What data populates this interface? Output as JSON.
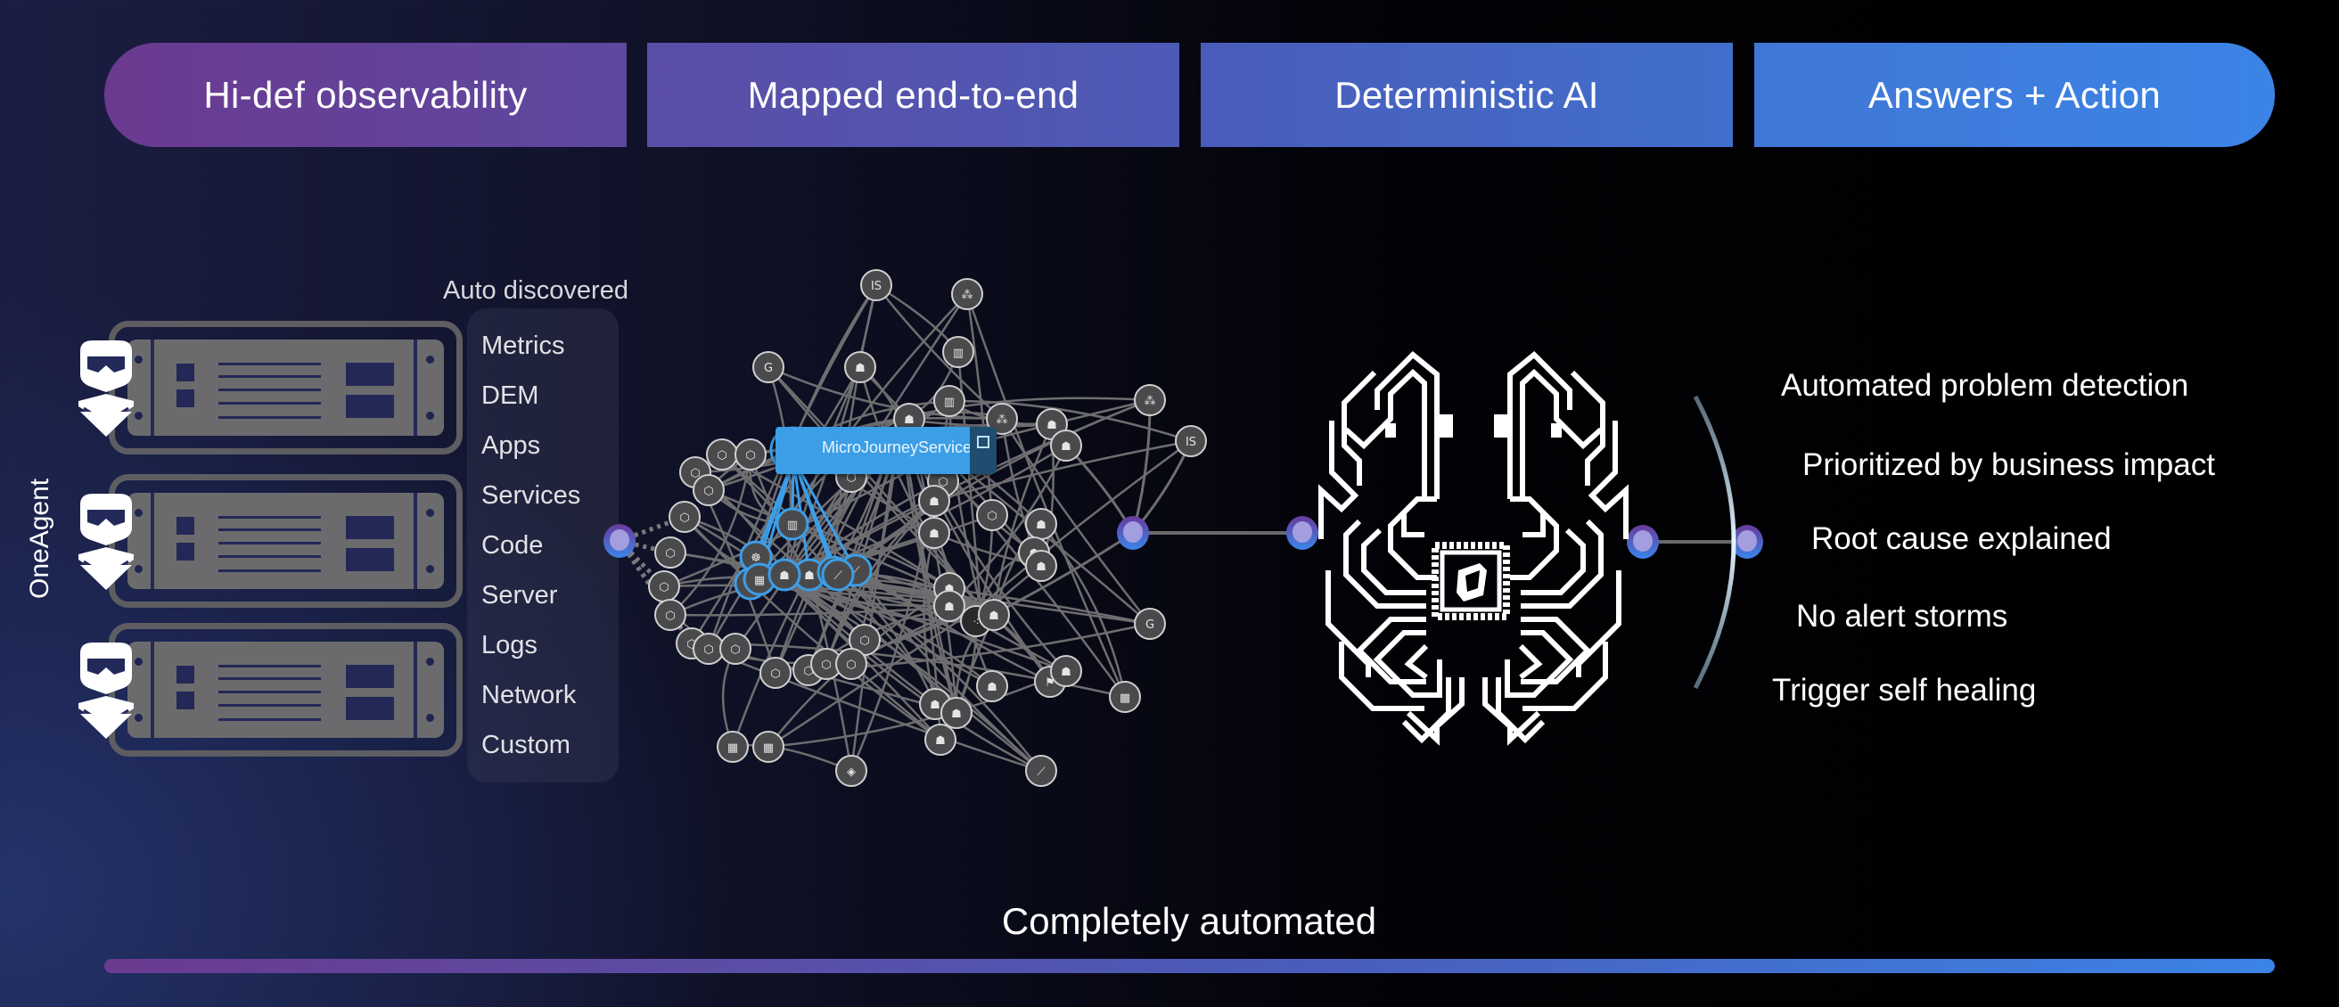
{
  "stages": [
    {
      "label": "Hi-def observability"
    },
    {
      "label": "Mapped end-to-end"
    },
    {
      "label": "Deterministic AI"
    },
    {
      "label": "Answers + Action"
    }
  ],
  "agent": {
    "label": "OneAgent",
    "icon": "oneagent-logo-icon",
    "server_icon": "server-rack-icon",
    "server_count": 3
  },
  "discovery": {
    "title": "Auto discovered",
    "items": [
      "Metrics",
      "DEM",
      "Apps",
      "Services",
      "Code",
      "Server",
      "Logs",
      "Network",
      "Custom"
    ]
  },
  "topology": {
    "selected_service": "MicroJourneyService",
    "open_icon": "external-link-icon",
    "node_icon_types": [
      "iis-icon",
      "aspnet-icon",
      "golang-icon",
      "java-icon",
      "nodejs-icon",
      "database-icon",
      "container-icon",
      "kubernetes-icon",
      "nginx-icon",
      "feather-icon",
      "cluster-icon",
      "firewall-icon"
    ]
  },
  "ai": {
    "icon": "circuit-brain-icon",
    "chip_icon": "dynatrace-cube-icon"
  },
  "answers": {
    "items": [
      "Automated problem detection",
      "Prioritized by business impact",
      "Root cause explained",
      "No alert storms",
      "Trigger self healing"
    ]
  },
  "footer": {
    "label": "Completely automated"
  },
  "colors": {
    "stage_start": "#6a3a90",
    "stage_end": "#3b84e6",
    "node_fill": "#4a4a4c",
    "node_stroke": "#d0d0d0",
    "edge": "#6e6e70",
    "highlight": "#3c9ee6",
    "connector": "#5a63d8"
  }
}
